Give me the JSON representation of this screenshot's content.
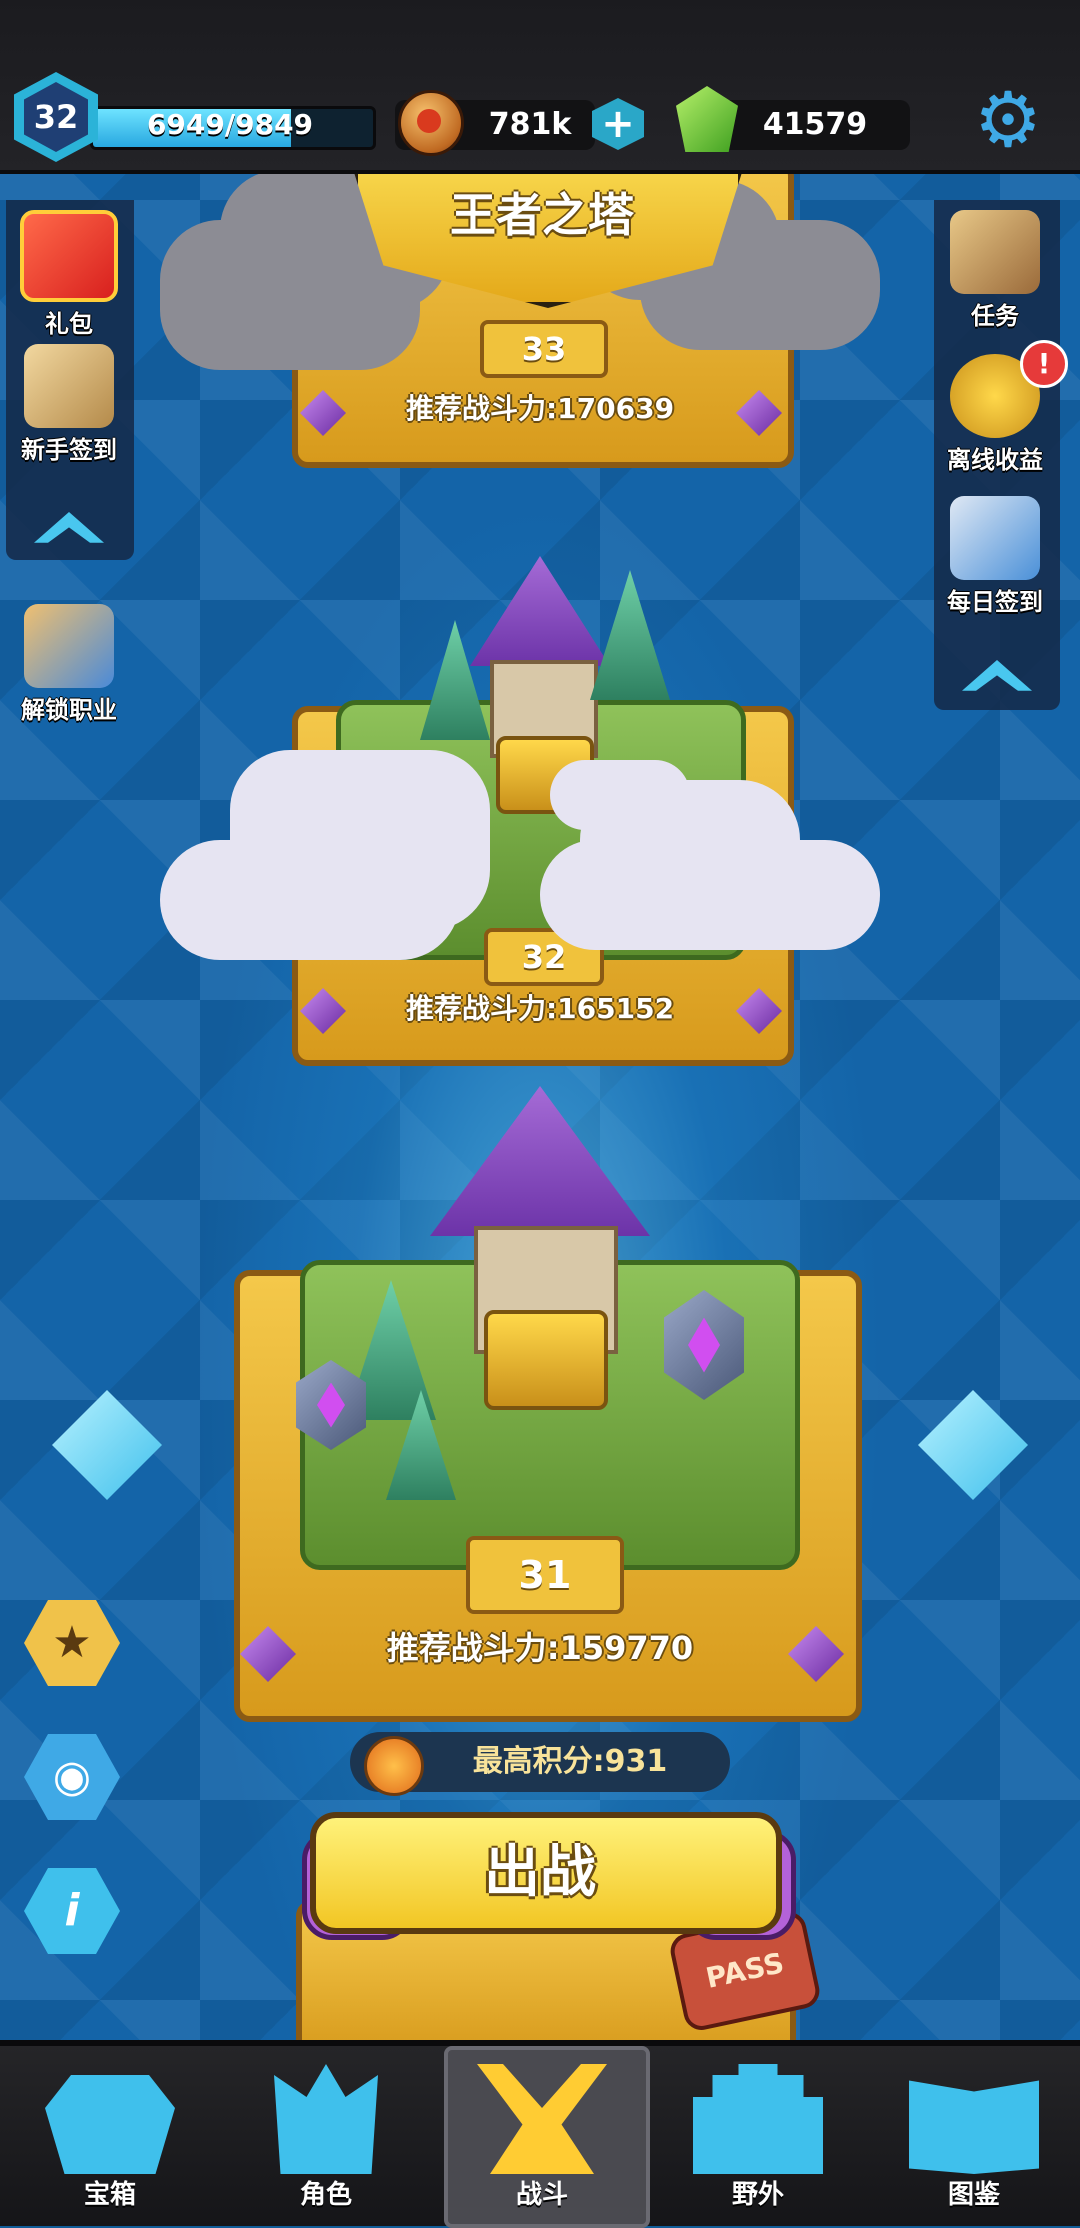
{
  "player": {
    "level": "32",
    "xp": "6949/9849",
    "xp_fraction": 0.7056,
    "coins": "781k",
    "gems": "41579",
    "add_label": "+"
  },
  "title": "王者之塔",
  "left_menu": [
    {
      "label": "礼包",
      "icon": "gift-box-icon"
    },
    {
      "label": "新手签到",
      "icon": "scroll-quill-icon"
    },
    {
      "label": "解锁职业",
      "icon": "unlock-chest-icon"
    }
  ],
  "right_menu": [
    {
      "label": "任务",
      "icon": "quest-map-icon"
    },
    {
      "label": "离线收益",
      "icon": "gold-coin-icon",
      "badge": "!"
    },
    {
      "label": "每日签到",
      "icon": "checklist-icon"
    }
  ],
  "floors": [
    {
      "number": "33",
      "power": "推荐战斗力:170639"
    },
    {
      "number": "32",
      "power": "推荐战斗力:165152"
    },
    {
      "number": "31",
      "power": "推荐战斗力:159770"
    }
  ],
  "best_score": "最高积分:931",
  "battle_button": "出战",
  "pass_label": "PASS",
  "tools": [
    {
      "icon": "medal-icon",
      "glyph": "★"
    },
    {
      "icon": "eye-icon",
      "glyph": "◉"
    },
    {
      "icon": "info-icon",
      "glyph": "i"
    }
  ],
  "nav": [
    {
      "label": "宝箱",
      "icon": "chest-icon"
    },
    {
      "label": "角色",
      "icon": "helmet-icon"
    },
    {
      "label": "战斗",
      "icon": "crossed-swords-icon"
    },
    {
      "label": "野外",
      "icon": "castle-icon"
    },
    {
      "label": "图鉴",
      "icon": "book-icon"
    }
  ],
  "colors": {
    "accent_blue": "#3fc0ec",
    "gold": "#f2c624",
    "purple": "#a56bd6",
    "active_nav": "#ffcc33"
  }
}
